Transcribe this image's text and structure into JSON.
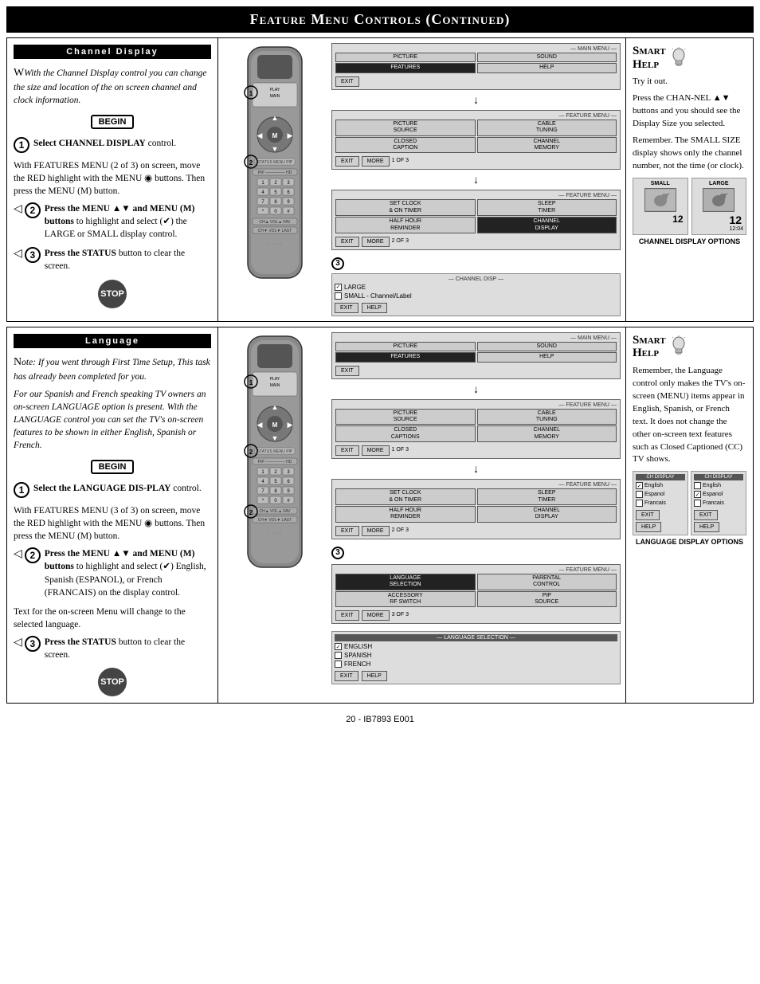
{
  "page": {
    "title": "Feature Menu Controls (Continued)",
    "footer": "20 - IB7893 E001"
  },
  "channel_display_section": {
    "title": "Channel Display",
    "smart_help_title": "Smart Help",
    "intro_text": "With the Channel Display control you can change the size and location of the on screen channel and clock information.",
    "begin_label": "BEGIN",
    "step1": {
      "num": "1",
      "text": "Select CHANNEL DISPLAY control."
    },
    "step2_label": "2",
    "step2_text": "Press the MENU ▲▼ and MENU (M) buttons to highlight and select (✔) the LARGE or SMALL display control.",
    "step3_label": "3",
    "step3_text": "Press the STATUS button to clear the screen.",
    "stop_label": "STOP",
    "with_features_text": "With FEATURES MENU (2 of 3) on screen, move the RED highlight with the MENU ◉ buttons. Then press the MENU (M) button.",
    "smart_help_body1": "Try it out.",
    "smart_help_body2": "Press the CHAN-NEL ▲▼ buttons and you should see the Display Size you selected.",
    "smart_help_body3": "Remember. The SMALL SIZE display shows only the channel number, not the time (or clock).",
    "channel_display_options_label": "CHANNEL DISPLAY OPTIONS",
    "screen1_label": "— MAIN MENU —",
    "screen1_buttons": [
      "PICTURE",
      "SOUND",
      "FEATURES",
      "HELP",
      "EXIT"
    ],
    "screen2_label": "— FEATURE MENU —",
    "screen2_buttons": [
      [
        "PICTURE SOURCE",
        "CABLE TUNING"
      ],
      [
        "CLOSED CAPTION",
        "CHANNEL MEMORY"
      ],
      [
        "EXIT",
        "MORE",
        "1 OF 3"
      ]
    ],
    "screen3_label": "— FEATURE MENU —",
    "screen3_buttons": [
      [
        "SET CLOCK & ON TIMER",
        "SLEEP TIMER"
      ],
      [
        "HALF HOUR REMINDER",
        "CHANNEL DISPLAY"
      ],
      [
        "EXIT",
        "MORE",
        "2 OF 3"
      ]
    ],
    "channel_disp_screen_label": "— CHANNEL DISP —",
    "channel_disp_options": [
      "LARGE",
      "SMALL - Channel/Label"
    ],
    "small_label": "SMALL",
    "large_label": "LARGE",
    "channel_num": "12",
    "channel_date": "12:04"
  },
  "language_section": {
    "title": "Language",
    "smart_help_title": "Smart Help",
    "note_text": "Note: If you went through First Time Setup, This task has already been completed for you.",
    "spanish_french_text": "For our Spanish and French speaking TV owners an on-screen LANGUAGE option is present. With the LANGUAGE control you can set the TV's on-screen features to be shown in either English, Spanish or French.",
    "begin_label": "BEGIN",
    "step1_text": "Select the LANGUAGE DISPLAY control.",
    "with_features_text": "With FEATURES MENU (3 of 3) on screen, move the RED highlight with the MENU ◉ buttons. Then press the MENU (M) button.",
    "step2_label": "2",
    "step2_text": "Press the MENU ▲▼ and MENU (M) buttons to highlight and select (✔) English, Spanish (ESPANOL), or French (FRANCAIS) on the display control.",
    "step3_label": "3",
    "step3_text": "Press the STATUS button to clear the screen.",
    "text_change_note": "Text for the on-screen Menu will change to the selected language.",
    "stop_label": "STOP",
    "smart_help_body": "Remember, the Language control only makes the TV's on-screen (MENU) items appear in English, Spanish, or French text. It does not change the other on-screen text features such as Closed Captioned (CC) TV shows.",
    "language_display_options_label": "LANGUAGE DISPLAY OPTIONS",
    "screen3_label": "— FEATURE MENU —",
    "screen3_lang_buttons": [
      [
        "LANGUAGE SELECTION",
        "PARENTAL CONTROL"
      ],
      [
        "ACCESSORY RF SWITCH",
        "PIP SOURCE"
      ],
      [
        "EXIT",
        "MORE",
        "3 OF 3"
      ]
    ],
    "lang_sel_title": "— LANGUAGE SELECTION —",
    "lang_options": [
      "ENGLISH",
      "SPANISH",
      "FRENCH"
    ],
    "lang_display_cols": {
      "col1_items": [
        "English",
        "Espanol",
        "Francais"
      ],
      "col2_items": [
        "CH DISPLAY",
        "English",
        "Espanol",
        "Francais"
      ]
    }
  }
}
